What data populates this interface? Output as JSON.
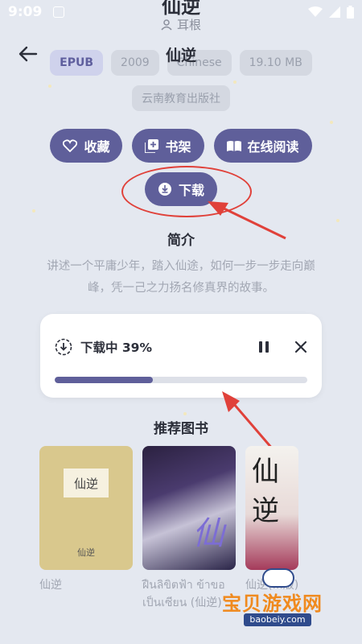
{
  "status_bar": {
    "time": "9:09"
  },
  "book": {
    "title_cut": "仙逆",
    "author": "耳根",
    "title_overlay": "仙逆",
    "format": "EPUB",
    "year": "2009",
    "language": "Chinese",
    "size": "19.10 MB",
    "publisher": "云南教育出版社"
  },
  "actions": {
    "favorite": "收藏",
    "bookshelf": "书架",
    "read_online": "在线阅读",
    "download": "下载"
  },
  "synopsis": {
    "heading": "简介",
    "text": "讲述一个平庸少年，踏入仙途，如何一步一步走向巅峰，凭一己之力扬名修真界的故事。"
  },
  "download_card": {
    "status": "下载中 39%",
    "progress": 0.39
  },
  "recommendations": {
    "heading": "推荐图书",
    "items": [
      {
        "cover_title": "仙逆",
        "cover_footer": "仙逆",
        "caption": "仙逆"
      },
      {
        "cover_title": "仙",
        "caption_line1": "ฝืนลิขิตฟ้า ข้าขอ",
        "caption_line2": "เป็นเซียน (仙逆)"
      },
      {
        "cover_title": "仙逆",
        "caption": "仙逆(...版)"
      }
    ]
  },
  "watermark": {
    "text": "宝贝游戏网",
    "url": "baobeiy.com"
  },
  "colors": {
    "accent": "#5f5f9a",
    "annotation": "#e0413a"
  }
}
